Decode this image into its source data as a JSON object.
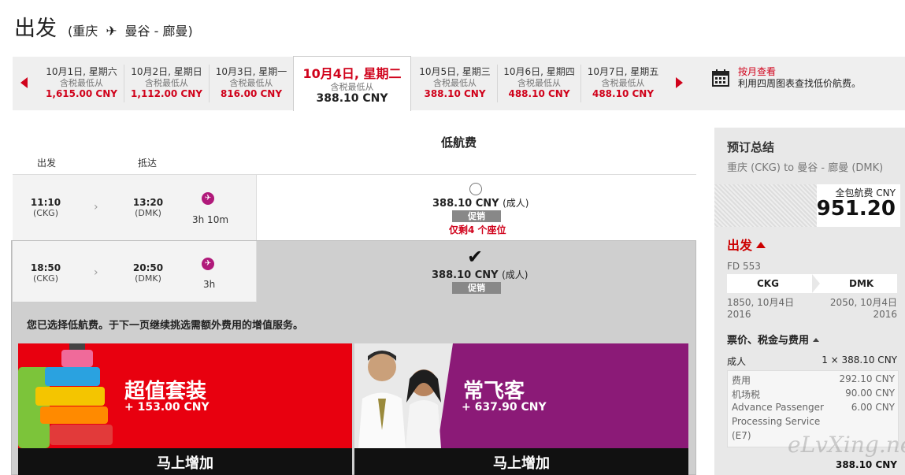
{
  "header": {
    "title": "出发",
    "route_from": "(重庆",
    "route_to": "曼谷 - 廊曼)"
  },
  "date_strip": {
    "dates": [
      {
        "label": "10月1日, 星期六",
        "sub": "含税最低从",
        "price": "1,615.00 CNY"
      },
      {
        "label": "10月2日, 星期日",
        "sub": "含税最低从",
        "price": "1,112.00 CNY"
      },
      {
        "label": "10月3日, 星期一",
        "sub": "含税最低从",
        "price": "816.00 CNY"
      },
      {
        "label": "10月4日, 星期二",
        "sub": "含税最低从",
        "price": "388.10 CNY"
      },
      {
        "label": "10月5日, 星期三",
        "sub": "含税最低从",
        "price": "388.10 CNY"
      },
      {
        "label": "10月6日, 星期四",
        "sub": "含税最低从",
        "price": "488.10 CNY"
      },
      {
        "label": "10月7日, 星期五",
        "sub": "含税最低从",
        "price": "488.10 CNY"
      }
    ],
    "monthly_link": "按月查看",
    "monthly_desc": "利用四周图表查找低价航费。"
  },
  "fares": {
    "column_title": "低航费",
    "col_depart": "出发",
    "col_arrive": "抵达",
    "flights": [
      {
        "dep_time": "11:10",
        "dep_code": "(CKG)",
        "arr_time": "13:20",
        "arr_code": "(DMK)",
        "duration": "3h 10m",
        "price": "388.10 CNY",
        "pax": "(成人)",
        "promo": "促销",
        "seats": "仅剩4 个座位"
      },
      {
        "dep_time": "18:50",
        "dep_code": "(CKG)",
        "arr_time": "20:50",
        "arr_code": "(DMK)",
        "duration": "3h",
        "price": "388.10 CNY",
        "pax": "(成人)",
        "promo": "促销"
      }
    ],
    "selected_note": "您已选择低航费。于下一页继续挑选需额外费用的增值服务。"
  },
  "upsells": [
    {
      "title": "超值套装",
      "amount": "+ 153.00 CNY",
      "button": "马上增加"
    },
    {
      "title": "常飞客",
      "amount": "+ 637.90 CNY",
      "button": "马上增加"
    }
  ],
  "summary": {
    "title": "预订总结",
    "route": "重庆 (CKG) to 曼谷 - 廊曼 (DMK)",
    "total_label": "全包航费 CNY",
    "total_value": "951.20",
    "depart_label": "出发",
    "flight_no": "FD 553",
    "from_code": "CKG",
    "to_code": "DMK",
    "dep_dt": "1850, 10月4日",
    "dep_year": "2016",
    "arr_dt": "2050, 10月4日",
    "arr_year": "2016",
    "price_section": "票价、税金与费用",
    "adult_label": "成人",
    "adult_value": "1 × 388.10 CNY",
    "fees": [
      {
        "label": "费用",
        "value": "292.10 CNY"
      },
      {
        "label": "机场税",
        "value": "90.00 CNY"
      },
      {
        "label": "Advance Passenger",
        "value": "6.00 CNY"
      },
      {
        "label": "Processing Service",
        "value": ""
      },
      {
        "label": "(E7)",
        "value": ""
      }
    ],
    "subtotal": "388.10 CNY"
  },
  "watermark": "eLvXing.net",
  "colors": {
    "accent_red": "#d0021b",
    "upsell_red": "#e8000f",
    "upsell_purple": "#8b1a77"
  }
}
